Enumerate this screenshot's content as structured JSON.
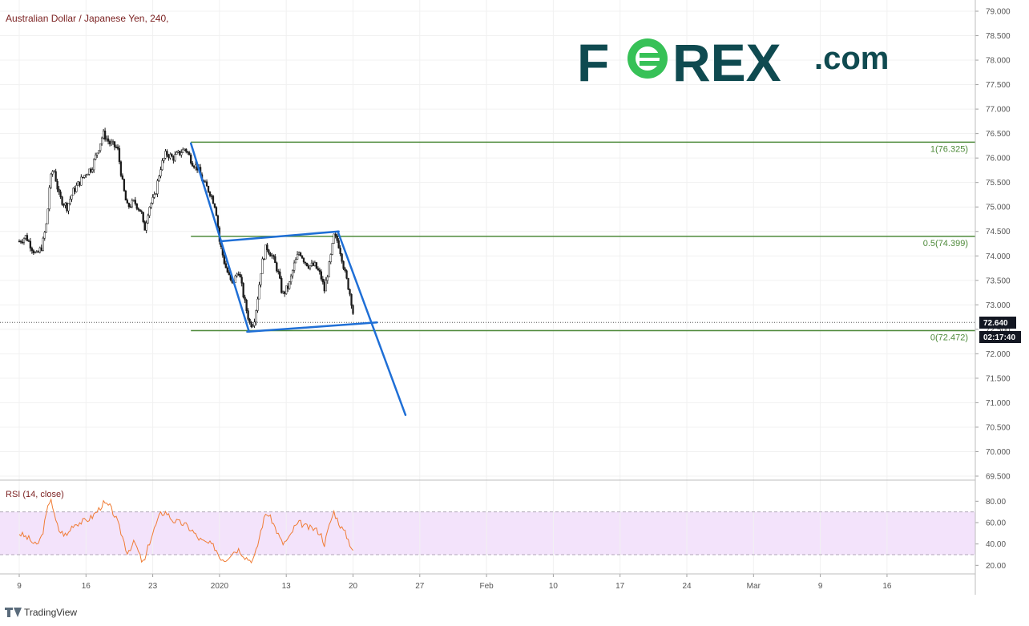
{
  "chart_data": {
    "type": "candlestick",
    "title": "Australian Dollar / Japanese Yen, 240,",
    "ylim": [
      69.5,
      79.0
    ],
    "y_ticks": [
      "69.500",
      "70.000",
      "70.500",
      "71.000",
      "71.500",
      "72.000",
      "72.500",
      "73.000",
      "73.500",
      "74.000",
      "74.500",
      "75.000",
      "75.500",
      "76.000",
      "76.500",
      "77.000",
      "77.500",
      "78.000",
      "78.500",
      "79.000"
    ],
    "x_ticks": [
      "9",
      "16",
      "23",
      "2020",
      "13",
      "20",
      "27",
      "Feb",
      "10",
      "17",
      "24",
      "Mar",
      "9",
      "16"
    ],
    "last_price": 72.64,
    "last_price_label": "72.640",
    "countdown_label": "02:17:40",
    "price_path": [
      [
        0,
        74.3
      ],
      [
        0.7,
        74.4
      ],
      [
        1.8,
        74.0
      ],
      [
        2.4,
        74.2
      ],
      [
        2.9,
        74.7
      ],
      [
        3.2,
        75.5
      ],
      [
        3.6,
        75.8
      ],
      [
        4.2,
        75.2
      ],
      [
        5.0,
        75.0
      ],
      [
        5.6,
        75.3
      ],
      [
        6.3,
        75.5
      ],
      [
        7.0,
        75.7
      ],
      [
        7.6,
        75.8
      ],
      [
        8.3,
        76.2
      ],
      [
        8.8,
        76.5
      ],
      [
        9.5,
        76.3
      ],
      [
        10.3,
        76.2
      ],
      [
        10.9,
        75.4
      ],
      [
        11.3,
        75.0
      ],
      [
        12.1,
        75.1
      ],
      [
        12.8,
        74.9
      ],
      [
        13.1,
        74.5
      ],
      [
        13.6,
        75.0
      ],
      [
        14.2,
        75.2
      ],
      [
        14.8,
        75.8
      ],
      [
        15.4,
        76.1
      ],
      [
        16.1,
        76.0
      ],
      [
        16.8,
        76.1
      ],
      [
        17.4,
        76.2
      ],
      [
        18.2,
        75.9
      ],
      [
        18.7,
        75.8
      ],
      [
        19.3,
        75.5
      ],
      [
        20.0,
        75.3
      ],
      [
        20.6,
        75.0
      ],
      [
        21.0,
        74.3
      ],
      [
        21.6,
        73.8
      ],
      [
        22.3,
        73.4
      ],
      [
        23.0,
        73.7
      ],
      [
        23.7,
        73.0
      ],
      [
        24.2,
        72.6
      ],
      [
        24.6,
        72.65
      ],
      [
        24.9,
        73.0
      ],
      [
        25.4,
        73.8
      ],
      [
        25.9,
        74.2
      ],
      [
        26.5,
        74.0
      ],
      [
        27.1,
        73.7
      ],
      [
        27.6,
        73.2
      ],
      [
        28.3,
        73.4
      ],
      [
        28.8,
        73.8
      ],
      [
        29.4,
        74.1
      ],
      [
        29.9,
        73.9
      ],
      [
        30.4,
        73.8
      ],
      [
        31.0,
        73.8
      ],
      [
        31.6,
        73.6
      ],
      [
        32.0,
        73.3
      ],
      [
        32.6,
        73.9
      ],
      [
        33.0,
        74.4
      ],
      [
        33.4,
        74.3
      ],
      [
        33.8,
        74.0
      ],
      [
        34.2,
        73.6
      ],
      [
        34.6,
        73.3
      ],
      [
        34.9,
        73.0
      ],
      [
        35.1,
        72.64
      ]
    ],
    "rsi": {
      "label": "RSI (14, close)",
      "ylim": [
        15,
        90
      ],
      "band": [
        30,
        70
      ],
      "ticks": [
        "80.00",
        "60.00",
        "40.00",
        "20.00"
      ],
      "tick_values": [
        80,
        60,
        40,
        20
      ],
      "path": [
        [
          0,
          50
        ],
        [
          1.0,
          45
        ],
        [
          1.8,
          38
        ],
        [
          2.4,
          48
        ],
        [
          2.9,
          70
        ],
        [
          3.3,
          85
        ],
        [
          3.7,
          65
        ],
        [
          4.2,
          52
        ],
        [
          5.0,
          48
        ],
        [
          5.6,
          58
        ],
        [
          6.3,
          60
        ],
        [
          7.0,
          62
        ],
        [
          7.6,
          65
        ],
        [
          8.3,
          72
        ],
        [
          8.8,
          78
        ],
        [
          9.5,
          75
        ],
        [
          10.1,
          65
        ],
        [
          10.9,
          45
        ],
        [
          11.3,
          32
        ],
        [
          12.1,
          42
        ],
        [
          12.8,
          25
        ],
        [
          13.1,
          22
        ],
        [
          13.6,
          40
        ],
        [
          14.2,
          55
        ],
        [
          14.8,
          68
        ],
        [
          15.4,
          70
        ],
        [
          16.1,
          62
        ],
        [
          16.8,
          60
        ],
        [
          17.4,
          58
        ],
        [
          18.2,
          52
        ],
        [
          18.7,
          46
        ],
        [
          19.3,
          42
        ],
        [
          20.0,
          40
        ],
        [
          20.6,
          36
        ],
        [
          21.0,
          28
        ],
        [
          21.6,
          25
        ],
        [
          22.3,
          32
        ],
        [
          23.0,
          35
        ],
        [
          23.7,
          28
        ],
        [
          24.2,
          25
        ],
        [
          24.6,
          26
        ],
        [
          24.9,
          35
        ],
        [
          25.4,
          55
        ],
        [
          25.9,
          70
        ],
        [
          26.5,
          62
        ],
        [
          27.1,
          50
        ],
        [
          27.6,
          40
        ],
        [
          28.3,
          45
        ],
        [
          28.8,
          55
        ],
        [
          29.4,
          60
        ],
        [
          29.9,
          57
        ],
        [
          30.4,
          55
        ],
        [
          31.0,
          54
        ],
        [
          31.6,
          50
        ],
        [
          32.0,
          40
        ],
        [
          32.6,
          60
        ],
        [
          33.0,
          70
        ],
        [
          33.4,
          62
        ],
        [
          33.8,
          55
        ],
        [
          34.2,
          50
        ],
        [
          34.6,
          42
        ],
        [
          34.9,
          36
        ],
        [
          35.1,
          32
        ]
      ]
    },
    "fibonacci": [
      {
        "label": "1(76.325)",
        "value": 76.325
      },
      {
        "label": "0.5(74.399)",
        "value": 74.399
      },
      {
        "label": "0(72.472)",
        "value": 72.472
      }
    ],
    "trendlines": [
      {
        "from": [
          18.0,
          76.3
        ],
        "to": [
          24.1,
          72.45
        ]
      },
      {
        "from": [
          21.1,
          74.3
        ],
        "to": [
          33.5,
          74.5
        ]
      },
      {
        "from": [
          23.9,
          72.45
        ],
        "to": [
          37.5,
          72.64
        ]
      },
      {
        "from": [
          33.4,
          74.5
        ],
        "to": [
          40.5,
          70.75
        ]
      }
    ]
  },
  "colors": {
    "candles": "#1a1a1a",
    "rsi_line": "#f07c35",
    "rsi_band": "#f3e3fb",
    "fib_line": "#4e8a3a",
    "trend_line": "#1f6fd6",
    "price_tag_bg": "#131722",
    "logo_main": "#0f4a50",
    "logo_accent": "#37c157"
  },
  "branding": {
    "logo_left": "F",
    "logo_right": "REX",
    "logo_suffix": ".com",
    "tradingview": "TradingView"
  }
}
